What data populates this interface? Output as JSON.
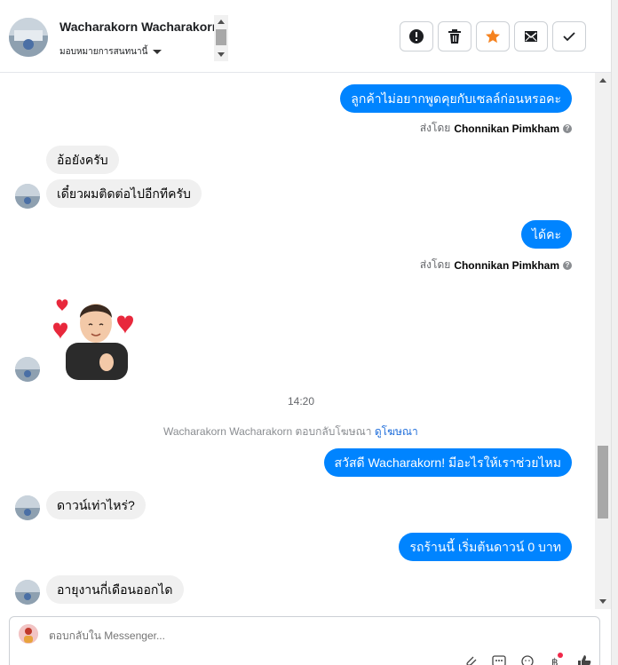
{
  "header": {
    "contact_name": "Wacharakorn Wacharakorn",
    "assign_label": "มอบหมายการสนทนานี้"
  },
  "actions": [
    {
      "name": "report",
      "icon": "exclamation-icon"
    },
    {
      "name": "delete",
      "icon": "trash-icon"
    },
    {
      "name": "star",
      "icon": "star-icon",
      "color": "#f5821f"
    },
    {
      "name": "mark-unread",
      "icon": "envelope-icon"
    },
    {
      "name": "done",
      "icon": "check-icon"
    }
  ],
  "messages": {
    "m1": "ลูกค้าไม่อยากพูดคุยกับเซลล์ก่อนหรอคะ",
    "m1_sent_prefix": "ส่งโดย",
    "m1_sent_by": "Chonnikan Pimkham",
    "m2": "อ้อยังครับ",
    "m3": "เดี๋ยวผมติดต่อไปอีกทีครับ",
    "m4": "ได้คะ",
    "m4_sent_prefix": "ส่งโดย",
    "m4_sent_by": "Chonnikan Pimkham",
    "time": "14:20",
    "ad_reply_text": "Wacharakorn Wacharakorn ตอบกลับโฆษณา",
    "ad_link": "ดูโฆษณา",
    "m5": "สวัสดี Wacharakorn! มีอะไรให้เราช่วยไหม",
    "m6": "ดาวน์เท่าไหร่?",
    "m7": "รถร้านนี้ เริ่มต้นดาวน์ 0 บาท",
    "m8": "อายุงานกี่เดือนออกได"
  },
  "composer": {
    "placeholder": "ตอบกลับใน Messenger..."
  },
  "colors": {
    "accent": "#0084ff",
    "star": "#f5821f"
  }
}
